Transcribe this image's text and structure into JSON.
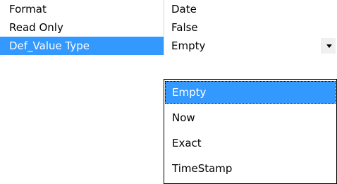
{
  "properties": [
    {
      "name": "Format",
      "value": "Date"
    },
    {
      "name": "Read Only",
      "value": "False"
    },
    {
      "name": "Def_Value Type",
      "value": "Empty"
    }
  ],
  "dropdown": {
    "options": [
      "Empty",
      "Now",
      "Exact",
      "TimeStamp"
    ],
    "highlighted": "Empty",
    "arrow_icon": "chevron-down-icon"
  },
  "colors": {
    "selection": "#3399ff",
    "selection_text": "#ffffff",
    "divider": "#d8d8d8",
    "dropdown_border": "#000000"
  }
}
